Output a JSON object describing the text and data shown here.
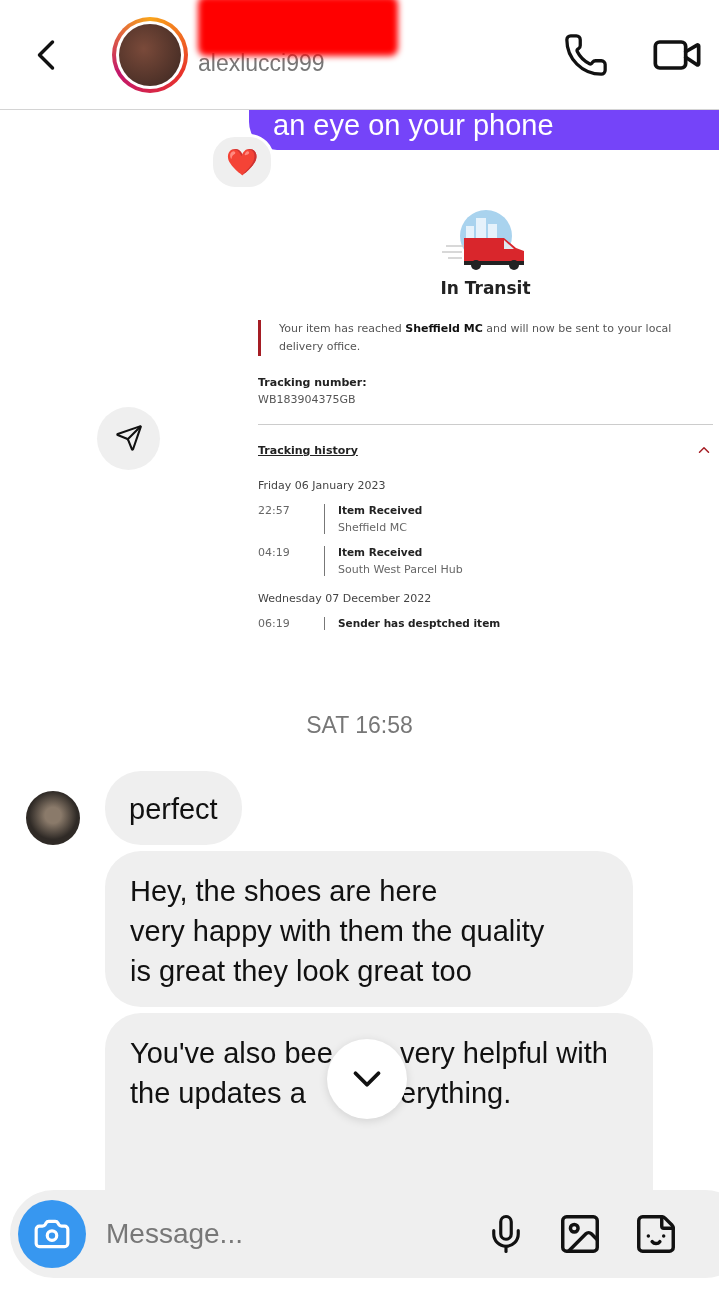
{
  "header": {
    "username": "alexlucci999",
    "redacted": true
  },
  "outgoing": {
    "text": "an eye on your phone",
    "reaction": "❤️"
  },
  "shared_post": {
    "title": "In Transit",
    "notice": "Your item has reached **Sheffield MC** and will now be sent to your local delivery office.",
    "tracking_label": "Tracking number:",
    "tracking_number": "WB183904375GB",
    "history_title": "Tracking history",
    "expanded": true,
    "days": [
      {
        "date": "Friday 06 January 2023",
        "events": [
          {
            "time": "22:57",
            "title": "Item Received",
            "location": "Sheffield MC"
          },
          {
            "time": "04:19",
            "title": "Item Received",
            "location": "South West Parcel Hub"
          }
        ]
      },
      {
        "date": "Wednesday 07 December 2022",
        "events": [
          {
            "time": "06:19",
            "title": "Sender has desptched item"
          }
        ]
      }
    ]
  },
  "timestamp": "SAT 16:58",
  "incoming": [
    {
      "show_avatar": true,
      "lines": [
        [
          "perfect"
        ]
      ]
    },
    {
      "show_avatar": false,
      "lines": [
        [
          "Hey, the shoes are here"
        ],
        [
          "very happy with them the quality"
        ],
        [
          "is great they look great too"
        ]
      ]
    },
    {
      "show_avatar": false,
      "lines": [
        [
          "You've also bee",
          "very helpful with"
        ],
        [
          "the updates a",
          "erything."
        ]
      ]
    }
  ],
  "composer": {
    "placeholder": "Message..."
  }
}
